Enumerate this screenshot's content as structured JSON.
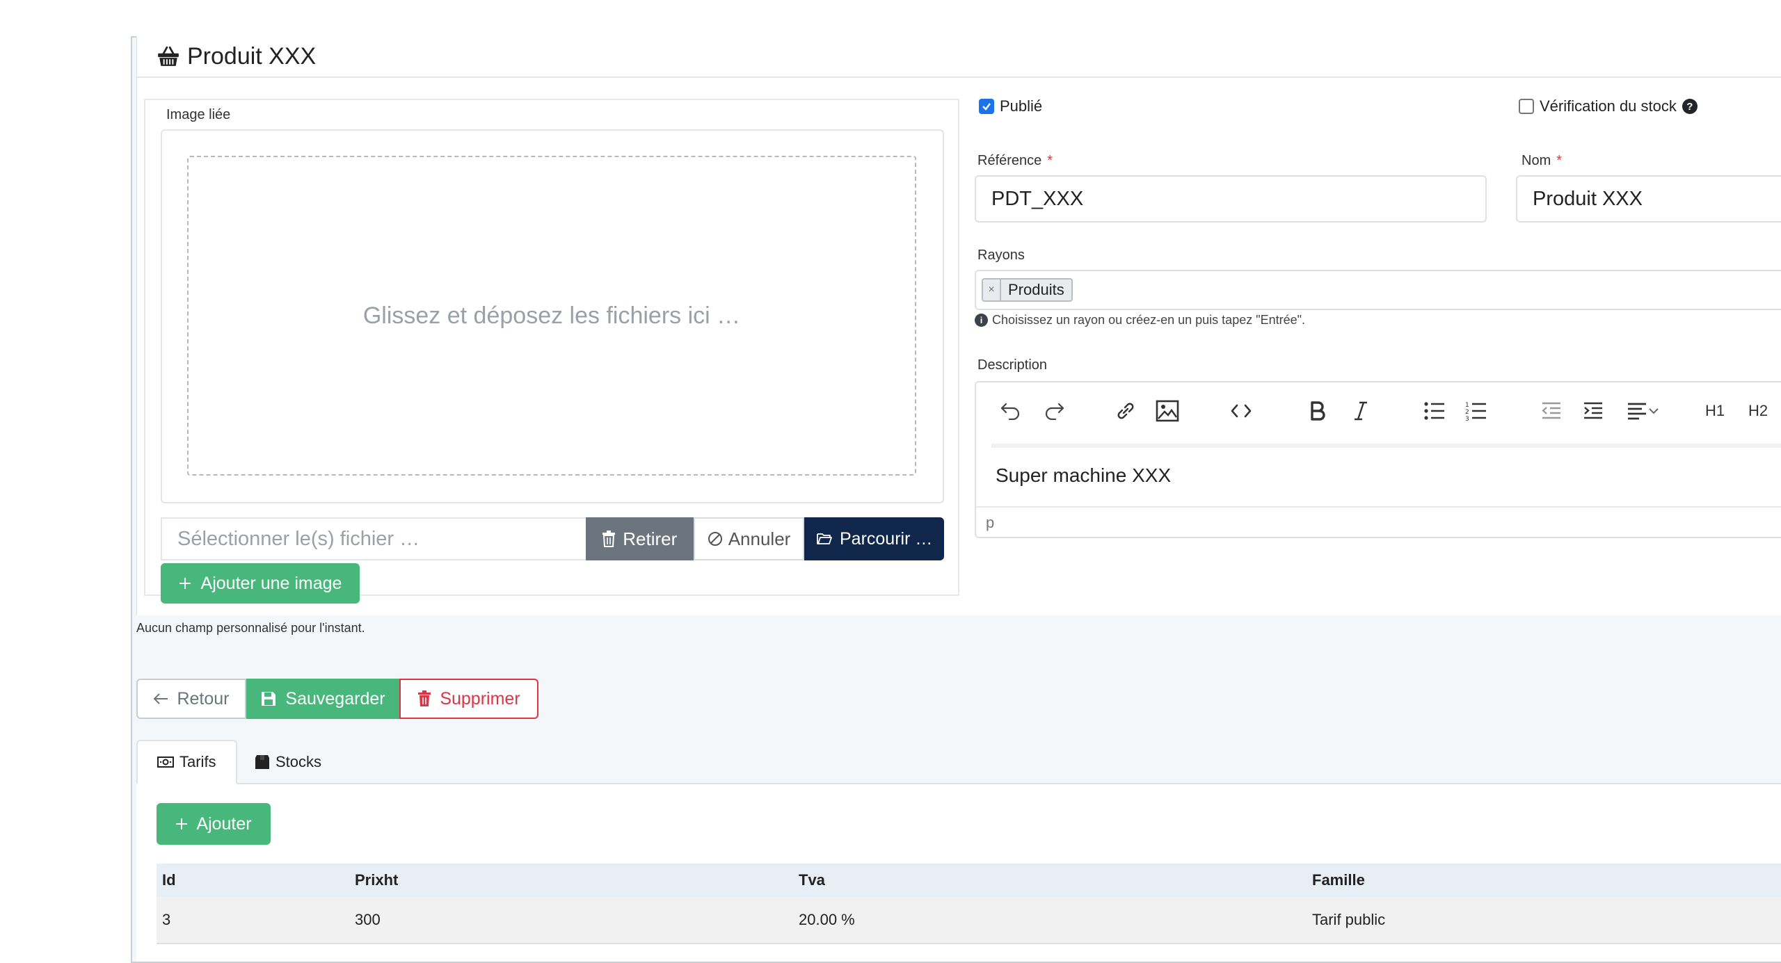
{
  "header": {
    "title": "Produit XXX",
    "icon": "basket-icon"
  },
  "image_panel": {
    "legend": "Image liée",
    "drop_text": "Glissez et déposez les fichiers ici …",
    "file_placeholder": "Sélectionner le(s) fichier …",
    "retirer_label": "Retirer",
    "annuler_label": "Annuler",
    "parcourir_label": "Parcourir …",
    "add_image_label": "Ajouter une image"
  },
  "form": {
    "publie_label": "Publié",
    "publie_checked": true,
    "stock_label": "Vérification du stock",
    "stock_checked": false,
    "reference_label": "Référence",
    "reference_value": "PDT_XXX",
    "nom_label": "Nom",
    "nom_value": "Produit XXX",
    "required_mark": "*",
    "rayons_label": "Rayons",
    "rayons_tags": [
      "Produits"
    ],
    "rayons_hint": "Choisissez un rayon ou créez-en un puis tapez \"Entrée\".",
    "description_label": "Description",
    "description_content": "Super machine XXX",
    "editor_status": "p",
    "toolbar_h1": "H1",
    "toolbar_h2": "H2"
  },
  "no_custom_fields": "Aucun champ personnalisé pour l'instant.",
  "actions": {
    "retour_label": "Retour",
    "save_label": "Sauvegarder",
    "delete_label": "Supprimer"
  },
  "tabs": [
    {
      "label": "Tarifs",
      "active": true
    },
    {
      "label": "Stocks",
      "active": false
    }
  ],
  "tarifs": {
    "add_label": "Ajouter",
    "columns": [
      "Id",
      "Prixht",
      "Tva",
      "Famille"
    ],
    "rows": [
      [
        "3",
        "300",
        "20.00 %",
        "Tarif public"
      ]
    ]
  },
  "colors": {
    "success": "#48b77c",
    "primary_dark": "#10264a",
    "danger": "#dc3545",
    "secondary": "#6c757d"
  }
}
